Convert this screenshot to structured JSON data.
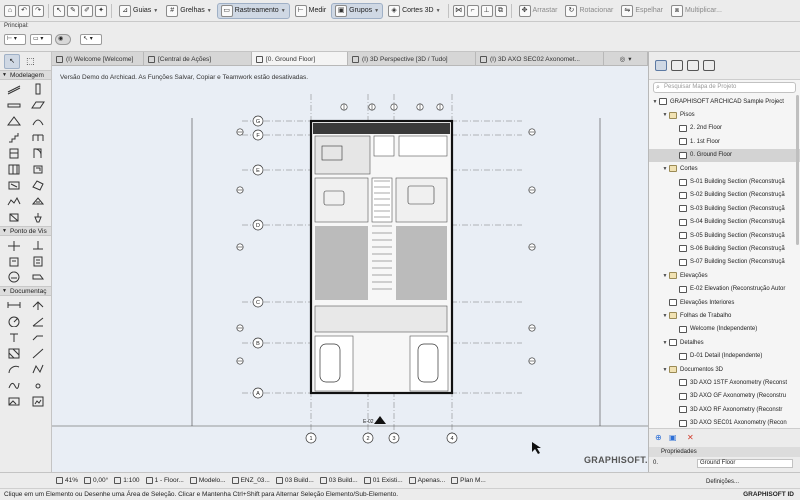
{
  "toolbar": {
    "items": [
      {
        "name": "guias",
        "label": "Guias"
      },
      {
        "name": "grelhas",
        "label": "Grelhas"
      },
      {
        "name": "rastreamento",
        "label": "Rastreamento"
      },
      {
        "name": "medir",
        "label": "Medir"
      },
      {
        "name": "grupos",
        "label": "Grupos"
      },
      {
        "name": "cortes3d",
        "label": "Cortes 3D"
      },
      {
        "name": "arrastar",
        "label": "Arrastar"
      },
      {
        "name": "rotacionar",
        "label": "Rotacionar"
      },
      {
        "name": "espelhar",
        "label": "Espelhar"
      },
      {
        "name": "multiplicar",
        "label": "Multiplicar..."
      }
    ]
  },
  "infobar": {
    "label": "Principal:"
  },
  "toolbox": {
    "sections": [
      "Modelagem",
      "Ponto de Vis",
      "Documentaç"
    ]
  },
  "tabs": [
    {
      "label": "(I) Welcome [Welcome]"
    },
    {
      "label": "[Central de Ações]"
    },
    {
      "label": "[0. Ground Floor]"
    },
    {
      "label": "(I) 3D Perspective [3D / Tudo]"
    },
    {
      "label": "(I) 3D AXO SEC02 Axonomet..."
    }
  ],
  "canvas": {
    "notice": "Versão Demo do Archicad. As Funções Salvar, Copiar e Teamwork estão desativadas.",
    "brand": "GRAPHISOFT.",
    "grid_rows": [
      "G",
      "F",
      "E",
      "D",
      "C",
      "B",
      "A"
    ],
    "grid_cols": [
      "1",
      "2",
      "3",
      "4"
    ],
    "section_mark": "E-02"
  },
  "navigator": {
    "search_placeholder": "Pesquisar Mapa de Projeto",
    "tree": [
      {
        "indent": 0,
        "twisty": "▼",
        "icon": "project-icon",
        "label": "GRAPHISOFT ARCHICAD Sample Project"
      },
      {
        "indent": 1,
        "twisty": "▼",
        "icon": "folder-icon",
        "label": "Pisos"
      },
      {
        "indent": 2,
        "twisty": "",
        "icon": "floor-icon",
        "label": "2. 2nd Floor"
      },
      {
        "indent": 2,
        "twisty": "",
        "icon": "floor-icon",
        "label": "1. 1st Floor"
      },
      {
        "indent": 2,
        "twisty": "",
        "icon": "floor-icon",
        "label": "0. Ground Floor",
        "selected": true
      },
      {
        "indent": 1,
        "twisty": "▼",
        "icon": "folder-icon",
        "label": "Cortes"
      },
      {
        "indent": 2,
        "twisty": "",
        "icon": "section-icon",
        "label": "S-01 Building Section (Reconstruçã"
      },
      {
        "indent": 2,
        "twisty": "",
        "icon": "section-icon",
        "label": "S-02 Building Section (Reconstruçã"
      },
      {
        "indent": 2,
        "twisty": "",
        "icon": "section-icon",
        "label": "S-03 Building Section (Reconstruçã"
      },
      {
        "indent": 2,
        "twisty": "",
        "icon": "section-icon",
        "label": "S-04 Building Section (Reconstruçã"
      },
      {
        "indent": 2,
        "twisty": "",
        "icon": "section-icon",
        "label": "S-05 Building Section (Reconstruçã"
      },
      {
        "indent": 2,
        "twisty": "",
        "icon": "section-icon",
        "label": "S-06 Building Section (Reconstruçã"
      },
      {
        "indent": 2,
        "twisty": "",
        "icon": "section-icon",
        "label": "S-07 Building Section (Reconstruçã"
      },
      {
        "indent": 1,
        "twisty": "▼",
        "icon": "folder-icon",
        "label": "Elevações"
      },
      {
        "indent": 2,
        "twisty": "",
        "icon": "elevation-icon",
        "label": "E-02 Elevation (Reconstrução Autor"
      },
      {
        "indent": 1,
        "twisty": "",
        "icon": "interior-elevation-icon",
        "label": "Elevações Interiores"
      },
      {
        "indent": 1,
        "twisty": "▼",
        "icon": "folder-icon",
        "label": "Folhas de Trabalho"
      },
      {
        "indent": 2,
        "twisty": "",
        "icon": "worksheet-icon",
        "label": "Welcome (Independente)"
      },
      {
        "indent": 1,
        "twisty": "▼",
        "icon": "detail-icon",
        "label": "Detalhes"
      },
      {
        "indent": 2,
        "twisty": "",
        "icon": "detail-icon",
        "label": "D-01 Detail (Independente)"
      },
      {
        "indent": 1,
        "twisty": "▼",
        "icon": "folder-icon",
        "label": "Documentos 3D"
      },
      {
        "indent": 2,
        "twisty": "",
        "icon": "axo-icon",
        "label": "3D AXO 1STF Axonometry (Reconst"
      },
      {
        "indent": 2,
        "twisty": "",
        "icon": "axo-icon",
        "label": "3D AXO GF Axonometry (Reconstru"
      },
      {
        "indent": 2,
        "twisty": "",
        "icon": "axo-icon",
        "label": "3D AXO RF Axonometry (Reconstr"
      },
      {
        "indent": 2,
        "twisty": "",
        "icon": "axo-icon",
        "label": "3D AXO SEC01 Axonometry (Recon"
      }
    ],
    "properties_label": "Propriedades",
    "prop_key": "0.",
    "prop_value": "Ground Floor",
    "definitions_button": "Definições..."
  },
  "statusbar": {
    "items": [
      "41%",
      "0,00°",
      "1:100",
      "1 - Floor...",
      "Modelo...",
      "ENZ_03...",
      "03 Build...",
      "03 Build...",
      "01 Existi...",
      "Apenas...",
      "Plan M..."
    ]
  },
  "hint": "Clique em um Elemento ou Desenhe uma Área de Seleção. Clicar e Mantenha Ctrl+Shift para Alternar Seleção Elemento/Sub-Elemento.",
  "graphisoft_id": "GRAPHISOFT ID"
}
